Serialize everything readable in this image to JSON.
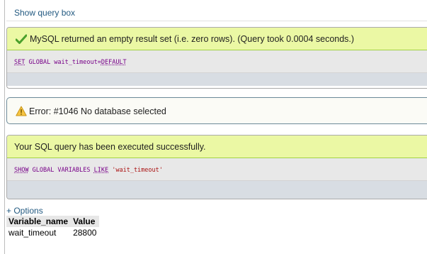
{
  "show_query_box": "Show query box",
  "block1": {
    "message": "MySQL returned an empty result set (i.e. zero rows). (Query took 0.0004 seconds.)",
    "sql": {
      "kw1": "SET",
      "var": "GLOBAL wait_timeout",
      "op": "=",
      "fn": "DEFAULT"
    }
  },
  "error": {
    "message": "Error: #1046 No database selected"
  },
  "block2": {
    "message": "Your SQL query has been executed successfully.",
    "sql": {
      "kw1": "SHOW",
      "kw2": "GLOBAL VARIABLES",
      "kw3": "LIKE",
      "str": "'wait_timeout'"
    }
  },
  "options_link": "+ Options",
  "results": {
    "headers": [
      "Variable_name",
      "Value"
    ],
    "rows": [
      [
        "wait_timeout",
        "28800"
      ]
    ]
  },
  "colors": {
    "success_bg": "#ebf8a4",
    "link": "#235a81",
    "keyword": "#770088",
    "string": "#aa1111"
  }
}
